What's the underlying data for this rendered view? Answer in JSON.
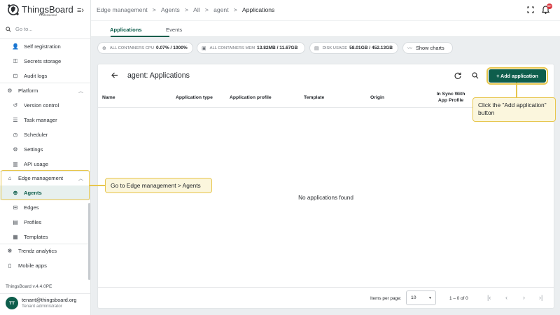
{
  "app": {
    "brand": "ThingsBoard",
    "brand_sub": "Professional",
    "search_placeholder": "Go to...",
    "version": "ThingsBoard v.4.4.0PE"
  },
  "sidebar": {
    "items": [
      {
        "label": "Self registration",
        "icon": "person-add-icon"
      },
      {
        "label": "Secrets storage",
        "icon": "key-icon"
      },
      {
        "label": "Audit logs",
        "icon": "audit-icon"
      },
      {
        "label": "Platform",
        "icon": "settings-group-icon"
      },
      {
        "label": "Version control",
        "icon": "history-icon"
      },
      {
        "label": "Task manager",
        "icon": "tasks-icon"
      },
      {
        "label": "Scheduler",
        "icon": "clock-icon"
      },
      {
        "label": "Settings",
        "icon": "gear-icon"
      },
      {
        "label": "API usage",
        "icon": "chart-icon"
      },
      {
        "label": "Edge management",
        "icon": "router-icon"
      },
      {
        "label": "Agents",
        "icon": "globe-icon"
      },
      {
        "label": "Edges",
        "icon": "router-icon"
      },
      {
        "label": "Profiles",
        "icon": "profile-icon"
      },
      {
        "label": "Templates",
        "icon": "template-icon"
      },
      {
        "label": "Trendz analytics",
        "icon": "trendz-icon"
      },
      {
        "label": "Mobile apps",
        "icon": "phone-icon"
      }
    ]
  },
  "user": {
    "initials": "TT",
    "email": "tenant@thingsboard.org",
    "role": "Tenant administrator"
  },
  "topbar": {
    "breadcrumbs": [
      "Edge management",
      "Agents",
      "All",
      "agent",
      "Applications"
    ],
    "separator": ">",
    "notification_badge": "99+"
  },
  "tabs": [
    "Applications",
    "Events"
  ],
  "stats": {
    "cpu_label": "ALL CONTAINERS CPU",
    "cpu_value": "0.07% / 1000%",
    "mem_label": "ALL CONTAINERS MEM",
    "mem_value": "13.82MB / 11.67GB",
    "disk_label": "DISK USAGE",
    "disk_value": "58.01GB / 452.13GB",
    "show_charts": "Show charts"
  },
  "card": {
    "title": "agent: Applications",
    "add_button": "+ Add application",
    "columns": [
      "Name",
      "Application type",
      "Application profile",
      "Template",
      "Origin",
      "In Sync With App Profile"
    ],
    "empty_text": "No applications found",
    "items_per_page_label": "Items per page:",
    "items_per_page_value": "10",
    "range_text": "1 – 0 of 0"
  },
  "callouts": {
    "edge_hint": "Go to Edge management > Agents",
    "add_hint": "Click the \"Add application\" button"
  },
  "colors": {
    "accent": "#0e5e4c",
    "highlight": "#e7c64d",
    "callout_bg": "#fbf6dd",
    "badge": "#d9363e"
  }
}
